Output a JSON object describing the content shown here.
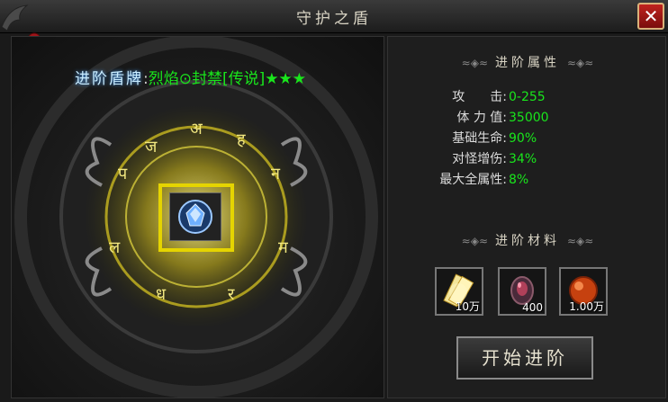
{
  "window": {
    "title": "守护之盾",
    "close_icon": "close-x-icon"
  },
  "shield": {
    "label": "进阶盾牌",
    "separator": ":",
    "name": "烈焰⊙封禁[传说]",
    "stars": "★★★",
    "name_color": "#19e61c"
  },
  "stats": {
    "heading": "进阶属性",
    "rows": [
      {
        "key": "攻　　击:",
        "value": "0-255"
      },
      {
        "key": "体 力 值:",
        "value": "35000"
      },
      {
        "key": "基础生命:",
        "value": "90%"
      },
      {
        "key": "对怪增伤:",
        "value": "34%"
      },
      {
        "key": "最大全属性:",
        "value": "8%"
      }
    ]
  },
  "materials": {
    "heading": "进阶材料",
    "items": [
      {
        "icon": "scroll-book-icon",
        "qty": "10万"
      },
      {
        "icon": "dark-crystal-icon",
        "qty": "400"
      },
      {
        "icon": "red-orb-icon",
        "qty": "1.00万"
      }
    ]
  },
  "action": {
    "label": "开始进阶"
  },
  "colors": {
    "accent_green": "#19e61c",
    "slot_yellow": "#e5d400",
    "close_red": "#c0231e"
  }
}
